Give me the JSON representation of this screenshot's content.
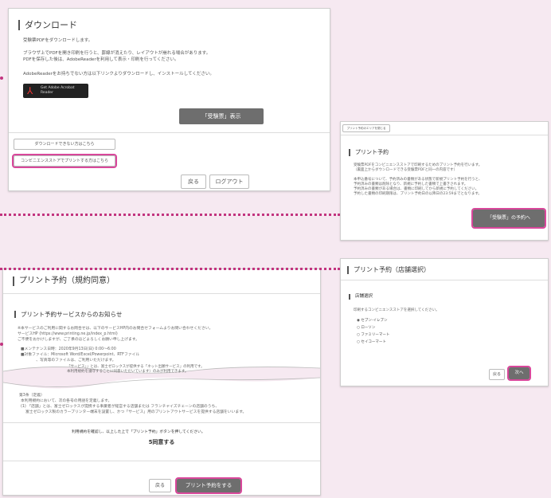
{
  "download": {
    "title": "ダウンロード",
    "text1": "受験票PDFをダウンロードします。",
    "text2": "ブラウザ上でPDFを開き印刷を行うと、罫線が消えたり、レイアウトが崩れる場合があります。",
    "text3": "PDFを保存した後は、AdobeReaderを利用して表示・印刷を行ってください。",
    "text4": "AdobeReaderをお持ちでない方は以下リンクよりダウンロードし、インストールしてください。",
    "adobe_label": "Get Adobe Acrobat Reader",
    "show_button": "「受験票」表示",
    "cannot_download": "ダウンロードできない方はこちら",
    "convenience_print": "コンビニエンスストアでプリントする方はこちら",
    "back_button": "戻る",
    "logout_button": "ログアウト"
  },
  "reserve": {
    "crumb": "プリント予約のエリアを閉じる",
    "title": "プリント予約",
    "text1": "受験票PDFをコンビニエンスストアで印刷するためのプリント予約を行います。",
    "text2": "（裏面上からダウンロードできる受験票PDFと同一の内容です）",
    "text3": "本申込番号について、予約済みの書類がある状態で新規プリント予約を行うと、",
    "text4": "予約済みの書類は削除となり、新規に予約した書類で上書きされます。",
    "text5": "予約済みの書類がある場合は、書類に印刷してから新規に予約してください。",
    "text6": "予約した書類の印刷期限は、プリント予約日の以降日の23:59までとなります。",
    "button": "「受験票」の予約へ"
  },
  "store": {
    "title": "プリント予約（店舗選択）",
    "section": "店舗選択",
    "prompt": "印刷するコンビニエンスストアを選択してください。",
    "options": [
      "セブン-イレブン",
      "ローソン",
      "ファミリーマート",
      "セイコーマート"
    ],
    "back_button": "戻る",
    "next_button": "次へ"
  },
  "terms": {
    "title": "プリント予約（規約同意）",
    "notice_title": "プリント予約サービスからのお知らせ",
    "line1": "※本サービスのご利用に関するお問合せは、以下のサービスHP内のお問合せフォームよりお問い合わせください。",
    "line2": "サービスHP (https://www.printing.ne.jp/index_p.html)",
    "line3": "ご不便をおかけしますが、ご了承のほどよろしくお願い申し上げます。",
    "line4": "■メンテナンス日時：2020年9月13日(日) 0:00～6:00",
    "line5": "■対象ファイル：Microsoft Word/Excel/Powerpoint、RTFファイル",
    "line6": "　　　　、写真等のファイルは、ご利用いただけます。",
    "line7": "「サービス」」とは、富士ゼロックスが提供する「ネット出願サービス」の利用です。",
    "line8": "本利用規約を遵守することに同意いただいています）のみが利用できます。",
    "line9": "第3条（定義）",
    "line10": "本利用規約において、次の各号の用語を定義します。",
    "line11": "(1) 「店舗」とは、富士ゼロックスが提携する事業者が経営する店舗または フランチャイズチェーンの店舗のうち、",
    "line12": "富士ゼロックス製のカラープリンター端末を設置し、かつ「サービス」用のプリントアウトサービスを提供する店舗をいいます。",
    "agree_prompt": "利用規約を確認し、以上した上で「プリント予約」ボタンを押してください。",
    "agree": "5同意する",
    "back_button": "戻る",
    "print_button": "プリント予約をする"
  }
}
